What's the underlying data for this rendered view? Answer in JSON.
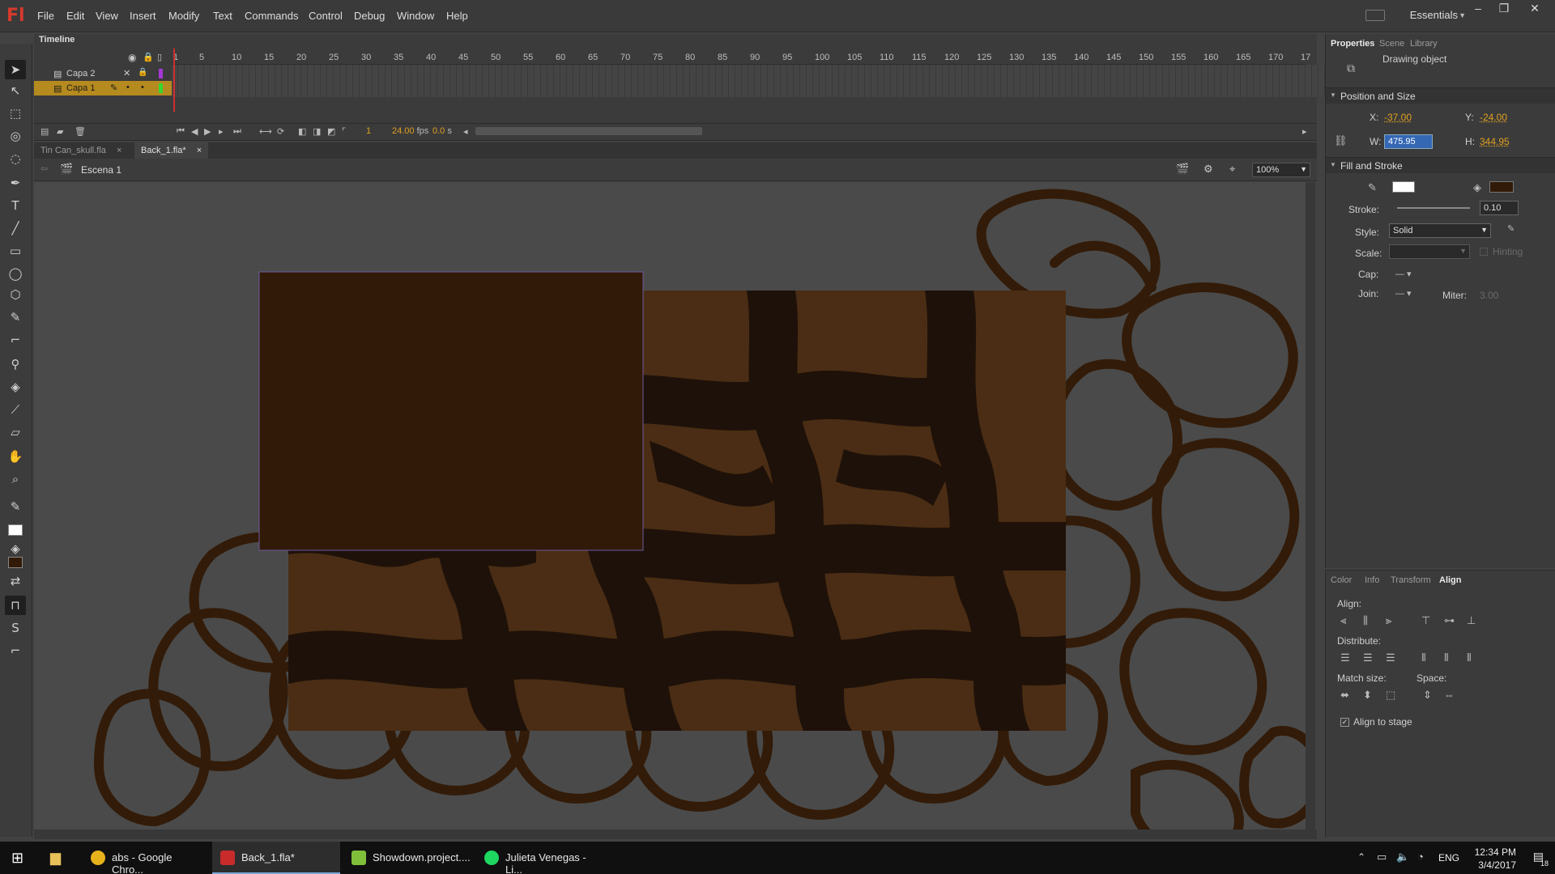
{
  "app": {
    "logo": "Fl",
    "menu": [
      "File",
      "Edit",
      "View",
      "Insert",
      "Modify",
      "Text",
      "Commands",
      "Control",
      "Debug",
      "Window",
      "Help"
    ],
    "workspace": "Essentials",
    "window_buttons": [
      "–",
      "❐",
      "✕"
    ]
  },
  "timeline": {
    "tab": "Timeline",
    "ruler": [
      "1",
      "5",
      "10",
      "15",
      "20",
      "25",
      "30",
      "35",
      "40",
      "45",
      "50",
      "55",
      "60",
      "65",
      "70",
      "75",
      "80",
      "85",
      "90",
      "95",
      "100",
      "105",
      "110",
      "115",
      "120",
      "125",
      "130",
      "135",
      "140",
      "145",
      "150",
      "155",
      "160",
      "165",
      "170",
      "17"
    ],
    "layers": [
      {
        "name": "Capa 2",
        "color": "#a637d6"
      },
      {
        "name": "Capa 1",
        "color": "#39d633"
      }
    ],
    "current_frame": "1",
    "fps": "24.00",
    "fps_unit": "fps",
    "time": "0.0",
    "time_unit": "s"
  },
  "doc_tabs": [
    {
      "label": "Tin Can_skull.fla",
      "close": "×"
    },
    {
      "label": "Back_1.fla*",
      "close": "×"
    }
  ],
  "editbar": {
    "scene": "Escena 1",
    "zoom": "100%"
  },
  "properties": {
    "tabs": [
      "Properties",
      "Scene",
      "Library"
    ],
    "object_type": "Drawing object",
    "position_size": {
      "heading": "Position and Size",
      "x_label": "X:",
      "x": "-37.00",
      "y_label": "Y:",
      "y": "-24.00",
      "w_label": "W:",
      "w": "475.95",
      "h_label": "H:",
      "h": "344.95"
    },
    "fill_stroke": {
      "heading": "Fill and Stroke",
      "fill_color": "#3a1e0c",
      "stroke_label": "Stroke:",
      "stroke": "0.10",
      "style_label": "Style:",
      "style": "Solid",
      "scale_label": "Scale:",
      "scale": "",
      "hinting": "Hinting",
      "cap_label": "Cap:",
      "join_label": "Join:",
      "miter_label": "Miter:",
      "miter": "3.00"
    }
  },
  "align_panel": {
    "tabs": [
      "Color",
      "Info",
      "Transform",
      "Align"
    ],
    "align_label": "Align:",
    "distribute_label": "Distribute:",
    "match_size_label": "Match size:",
    "space_label": "Space:",
    "align_to_stage": "Align to stage"
  },
  "taskbar": {
    "items": [
      {
        "label": "abs - Google Chro...",
        "icon_color": "#e7b21c"
      },
      {
        "label": "Back_1.fla*",
        "icon_color": "#c92b2b"
      },
      {
        "label": "Showdown.project....",
        "icon_color": "#7fbf3a"
      },
      {
        "label": "Julieta Venegas - Li...",
        "icon_color": "#1ed760"
      }
    ],
    "language": "ENG",
    "time": "12:34 PM",
    "date": "3/4/2017",
    "notifications": "18"
  },
  "colors": {
    "stage_bg": "#4a4a4a",
    "brown_fill": "#311a07",
    "texture_light": "#4a2d14",
    "texture_dark": "#1e1109",
    "outline": "#321b08",
    "accent_orange": "#e0a020"
  }
}
